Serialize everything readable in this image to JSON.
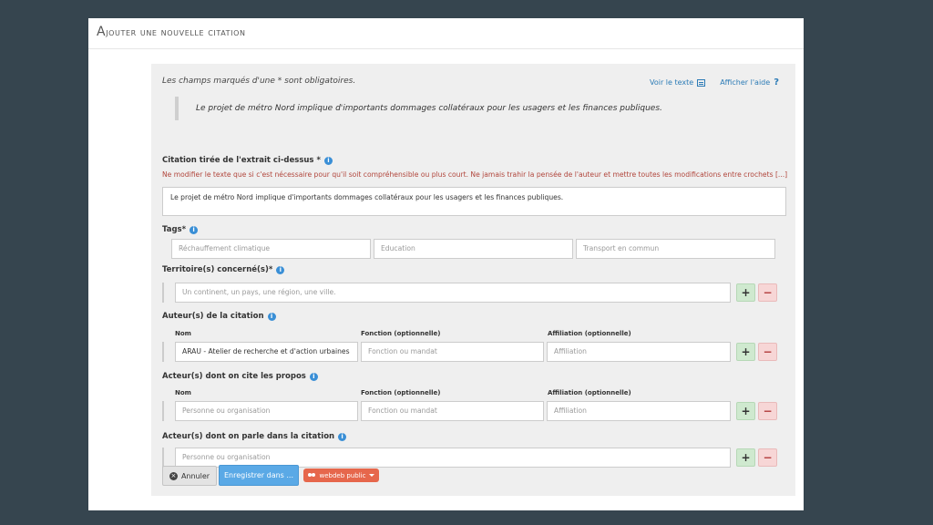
{
  "header": {
    "title_first": "A",
    "title_rest": "jouter une nouvelle citation"
  },
  "intro": "Les champs marqués d'une * sont obligatoires.",
  "links": {
    "view_text": "Voir le texte",
    "show_help": "Afficher l'aide"
  },
  "quote": "Le projet de métro Nord implique d'importants dommages collatéraux pour les usagers et les finances publiques.",
  "citation": {
    "label": "Citation tirée de l'extrait ci-dessus *",
    "warning": "Ne modifier le texte que si c'est nécessaire pour qu'il soit compréhensible ou plus court. Ne jamais trahir la pensée de l'auteur et mettre toutes les modifications entre crochets [...]",
    "value": "Le projet de métro Nord implique d'importants dommages collatéraux pour les usagers et les finances publiques."
  },
  "tags": {
    "label": "Tags*",
    "placeholders": [
      "Réchauffement climatique",
      "Education",
      "Transport en commun"
    ]
  },
  "territory": {
    "label": "Territoire(s) concerné(s)*",
    "placeholder": "Un continent, un pays, une région, une ville."
  },
  "authors": {
    "label": "Auteur(s) de la citation",
    "col_name": "Nom",
    "col_function": "Fonction (optionnelle)",
    "col_affiliation": "Affiliation (optionnelle)",
    "name_value": "ARAU - Atelier de recherche et d'action urbaines",
    "function_placeholder": "Fonction ou mandat",
    "affiliation_placeholder": "Affiliation"
  },
  "cited": {
    "label": "Acteur(s) dont on cite les propos",
    "col_name": "Nom",
    "col_function": "Fonction (optionnelle)",
    "col_affiliation": "Affiliation (optionnelle)",
    "name_placeholder": "Personne ou organisation",
    "function_placeholder": "Fonction ou mandat",
    "affiliation_placeholder": "Affiliation"
  },
  "mentioned": {
    "label": "Acteur(s) dont on parle dans la citation",
    "placeholder": "Personne ou organisation"
  },
  "buttons": {
    "cancel": "Annuler",
    "save": "Enregistrer dans ...",
    "public": "webdeb public",
    "plus": "+",
    "minus": "−"
  },
  "icons": {
    "info": "i",
    "help": "?",
    "close": "×"
  }
}
